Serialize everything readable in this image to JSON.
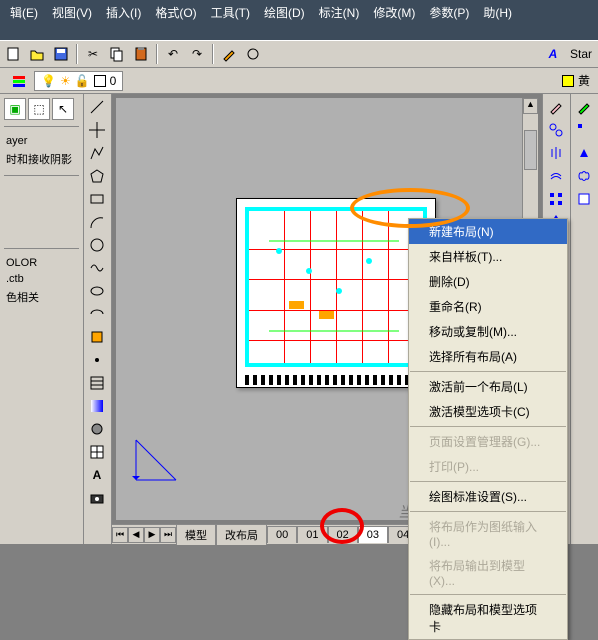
{
  "menubar": {
    "items": [
      "辑(E)",
      "视图(V)",
      "插入(I)",
      "格式(O)",
      "工具(T)",
      "绘图(D)",
      "标注(N)",
      "修改(M)",
      "参数(P)",
      "助(H)"
    ]
  },
  "toolbar_right": {
    "text_style": "Star"
  },
  "layerbar": {
    "current_layer": "0",
    "color_label": "黄",
    "icons": [
      "lightbulb",
      "sun",
      "lock",
      "color"
    ]
  },
  "left_panel": {
    "layer_name": "ayer",
    "shadow_label": "时和接收阴影",
    "color_label": "OLOR",
    "ctb": ".ctb",
    "related": "色相关"
  },
  "tabs": {
    "nav": [
      "⏮",
      "◀",
      "▶",
      "⏭"
    ],
    "items": [
      "模型",
      "改布局",
      "00",
      "01",
      "02",
      "03",
      "04"
    ]
  },
  "context_menu": {
    "items": [
      {
        "label": "新建布局(N)",
        "highlight": true,
        "disabled": false
      },
      {
        "label": "来自样板(T)...",
        "highlight": false,
        "disabled": false
      },
      {
        "label": "删除(D)",
        "highlight": false,
        "disabled": false
      },
      {
        "label": "重命名(R)",
        "highlight": false,
        "disabled": false
      },
      {
        "label": "移动或复制(M)...",
        "highlight": false,
        "disabled": false
      },
      {
        "label": "选择所有布局(A)",
        "highlight": false,
        "disabled": false
      },
      {
        "sep": true
      },
      {
        "label": "激活前一个布局(L)",
        "highlight": false,
        "disabled": false
      },
      {
        "label": "激活模型选项卡(C)",
        "highlight": false,
        "disabled": false
      },
      {
        "sep": true
      },
      {
        "label": "页面设置管理器(G)...",
        "highlight": false,
        "disabled": true
      },
      {
        "label": "打印(P)...",
        "highlight": false,
        "disabled": true
      },
      {
        "sep": true
      },
      {
        "label": "绘图标准设置(S)...",
        "highlight": false,
        "disabled": false
      },
      {
        "sep": true
      },
      {
        "label": "将布局作为图纸输入(I)...",
        "highlight": false,
        "disabled": true
      },
      {
        "label": "将布局输出到模型(X)...",
        "highlight": false,
        "disabled": true
      },
      {
        "sep": true
      },
      {
        "label": "隐藏布局和模型选项卡",
        "highlight": false,
        "disabled": false
      }
    ]
  },
  "watermark": "当下软件园 · danxia.com",
  "icons": {
    "cut": "✂",
    "copy": "⿻",
    "paste": "📋",
    "undo": "↶",
    "redo": "↷",
    "line": "╱",
    "rect": "▭",
    "circle": "○",
    "arc": "◠",
    "text": "A"
  }
}
